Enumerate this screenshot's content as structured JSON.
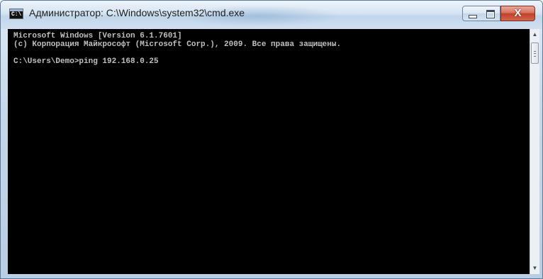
{
  "window": {
    "title": "Администратор: C:\\Windows\\system32\\cmd.exe",
    "icon": "console-icon",
    "controls": {
      "minimize": "minimize-icon",
      "maximize": "maximize-icon",
      "close_label": "X"
    }
  },
  "console": {
    "lines": [
      "Microsoft Windows [Version 6.1.7601]",
      "(c) Корпорация Майкрософт (Microsoft Corp.), 2009. Все права защищены.",
      "",
      "C:\\Users\\Demo>ping 192.168.0.25"
    ],
    "colors": {
      "background": "#000000",
      "text": "#c0c0c0"
    }
  },
  "scrollbar": {
    "up_arrow": "▲",
    "down_arrow": "▼"
  }
}
